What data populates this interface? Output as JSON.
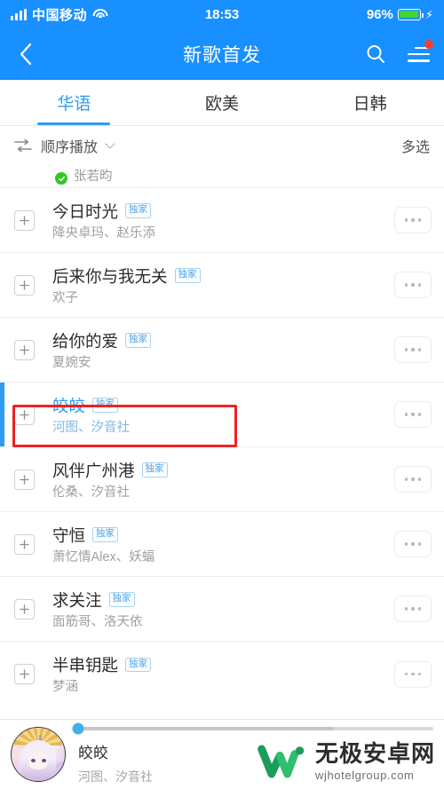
{
  "status_bar": {
    "carrier": "中国移动",
    "time": "18:53",
    "battery_percent": "96%",
    "battery_level": 96,
    "wifi_icon": "wifi-icon",
    "signal_icon": "signal-bars-icon",
    "charging_icon": "lightning-bolt-icon"
  },
  "header": {
    "title": "新歌首发",
    "back_icon": "chevron-left-icon",
    "search_icon": "search-icon",
    "menu_icon": "hamburger-menu-icon",
    "has_notification_dot": true,
    "background_color": "#1890ff"
  },
  "tabs": {
    "items": [
      {
        "label": "华语",
        "active": true
      },
      {
        "label": "欧美",
        "active": false
      },
      {
        "label": "日韩",
        "active": false
      }
    ],
    "active_color": "#2e9bf0"
  },
  "controls": {
    "play_mode_label": "顺序播放",
    "play_mode_icon": "sequential-play-icon",
    "chevron_icon": "chevron-down-icon",
    "multi_select_label": "多选"
  },
  "list": {
    "clipped_row": {
      "artist": "张若昀",
      "verified_icon": "verified-check-icon"
    },
    "add_icon": "plus-icon",
    "more_icon": "ellipsis-icon",
    "exclusive_badge": "独家",
    "songs": [
      {
        "title": "今日时光",
        "artist": "降央卓玛、赵乐添",
        "exclusive": true,
        "playing": false
      },
      {
        "title": "后来你与我无关",
        "artist": "欢子",
        "exclusive": true,
        "playing": false
      },
      {
        "title": "给你的爱",
        "artist": "夏婉安",
        "exclusive": true,
        "playing": false
      },
      {
        "title": "皎皎",
        "artist": "河图、汐音社",
        "exclusive": true,
        "playing": true
      },
      {
        "title": "风伴广州港",
        "artist": "伦桑、汐音社",
        "exclusive": true,
        "playing": false
      },
      {
        "title": "守恒",
        "artist": "萧忆情Alex、妖蝠",
        "exclusive": true,
        "playing": false
      },
      {
        "title": "求关注",
        "artist": "面筋哥、洛天依",
        "exclusive": true,
        "playing": false
      },
      {
        "title": "半串钥匙",
        "artist": "梦涵",
        "exclusive": true,
        "playing": false
      }
    ]
  },
  "annotation": {
    "color": "#ee2222"
  },
  "player": {
    "title": "皎皎",
    "artist": "河图、汐音社",
    "progress_percent": 0,
    "buffered_percent": 72,
    "album_art_name": "album-art"
  },
  "watermark": {
    "site_name": "无极安卓网",
    "url": "wjhotelgroup.com",
    "logo_color": "#1a9c5a"
  }
}
